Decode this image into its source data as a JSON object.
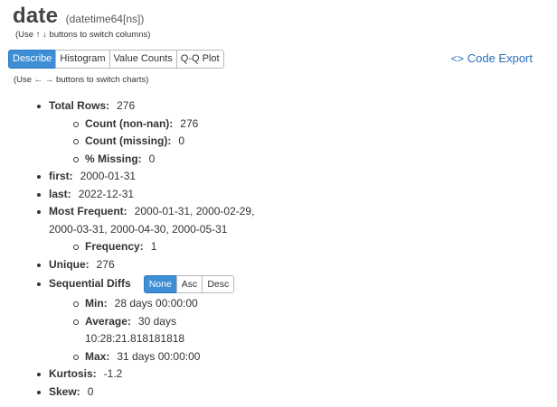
{
  "header": {
    "column_name": "date",
    "dtype": "(datetime64[ns])",
    "columns_hint": "(Use ↑ ↓ buttons to switch columns)",
    "charts_hint": "(Use ← → buttons to switch charts)"
  },
  "tabs": [
    {
      "label": "Describe",
      "active": true
    },
    {
      "label": "Histogram",
      "active": false
    },
    {
      "label": "Value Counts",
      "active": false
    },
    {
      "label": "Q-Q Plot",
      "active": false
    }
  ],
  "code_export": {
    "icon": "code-icon",
    "icon_glyph": "<>",
    "label": "Code Export"
  },
  "colors": {
    "active_button": "#3d8ed4",
    "link": "#2a6ebb"
  },
  "stats": {
    "total_rows": {
      "label": "Total Rows:",
      "value": "276"
    },
    "count_non_nan": {
      "label": "Count (non-nan):",
      "value": "276"
    },
    "count_missing": {
      "label": "Count (missing):",
      "value": "0"
    },
    "pct_missing": {
      "label": "% Missing:",
      "value": "0"
    },
    "first": {
      "label": "first:",
      "value": "2000-01-31"
    },
    "last": {
      "label": "last:",
      "value": "2022-12-31"
    },
    "most_frequent": {
      "label": "Most Frequent:",
      "value": "2000-01-31, 2000-02-29, 2000-03-31, 2000-04-30, 2000-05-31"
    },
    "frequency": {
      "label": "Frequency:",
      "value": "1"
    },
    "unique": {
      "label": "Unique:",
      "value": "276"
    },
    "sequential_diffs": {
      "label": "Sequential Diffs",
      "buttons": [
        {
          "label": "None",
          "active": true
        },
        {
          "label": "Asc",
          "active": false
        },
        {
          "label": "Desc",
          "active": false
        }
      ],
      "min": {
        "label": "Min:",
        "value": "28 days 00:00:00"
      },
      "average": {
        "label": "Average:",
        "value": "30 days 10:28:21.818181818"
      },
      "max": {
        "label": "Max:",
        "value": "31 days 00:00:00"
      }
    },
    "kurtosis": {
      "label": "Kurtosis:",
      "value": "-1.2"
    },
    "skew": {
      "label": "Skew:",
      "value": "0"
    }
  }
}
